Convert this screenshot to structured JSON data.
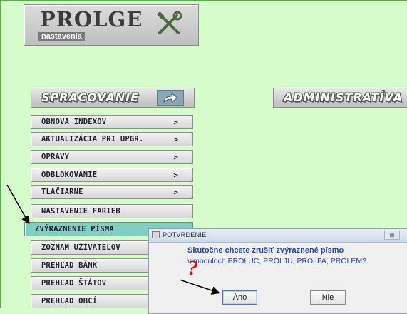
{
  "logo": {
    "title": "PROLGE",
    "subtitle": "nastavenia",
    "icon": "tools-icon"
  },
  "sections": {
    "left": {
      "label": "SPRACOVANIE",
      "icon": "arrow-right-icon"
    },
    "right": {
      "label": "ADMINISTRATÍVA"
    }
  },
  "menu": {
    "items": [
      {
        "label": "OBNOVA INDEXOV",
        "has_submenu": ">"
      },
      {
        "label": "AKTUALIZÁCIA PRI UPGR.",
        "has_submenu": ">"
      },
      {
        "label": "OPRAVY",
        "has_submenu": ">"
      },
      {
        "label": "ODBLOKOVANIE",
        "has_submenu": ">"
      },
      {
        "label": "TLAČIARNE",
        "has_submenu": ">"
      },
      {
        "label": "NASTAVENIE FARIEB"
      },
      {
        "label": "ZVÝRAZNENIE PÍSMA",
        "active": true
      },
      {
        "label": "ZOZNAM UŽÍVATEĽOV"
      },
      {
        "label": "PREHĽAD BÁNK"
      },
      {
        "label": "PREHĽAD ŠTÁTOV"
      },
      {
        "label": "PREHĽAD OBCÍ"
      }
    ]
  },
  "dialog": {
    "title": "POTVRDENIE",
    "close": "⊠",
    "icon": "question-mark-icon",
    "question_glyph": "?",
    "message_line1": "Skutočne chcete zrušiť zvýraznené písmo",
    "message_line2": "v moduloch PROLUC, PROLJU, PROLFA, PROLEM?",
    "yes_label": "Áno",
    "no_label": "Nie"
  },
  "colors": {
    "background": "#d7fccb",
    "active_item": "#7fd0c2",
    "message_text": "#2446b8",
    "question_mark": "#e01010"
  }
}
